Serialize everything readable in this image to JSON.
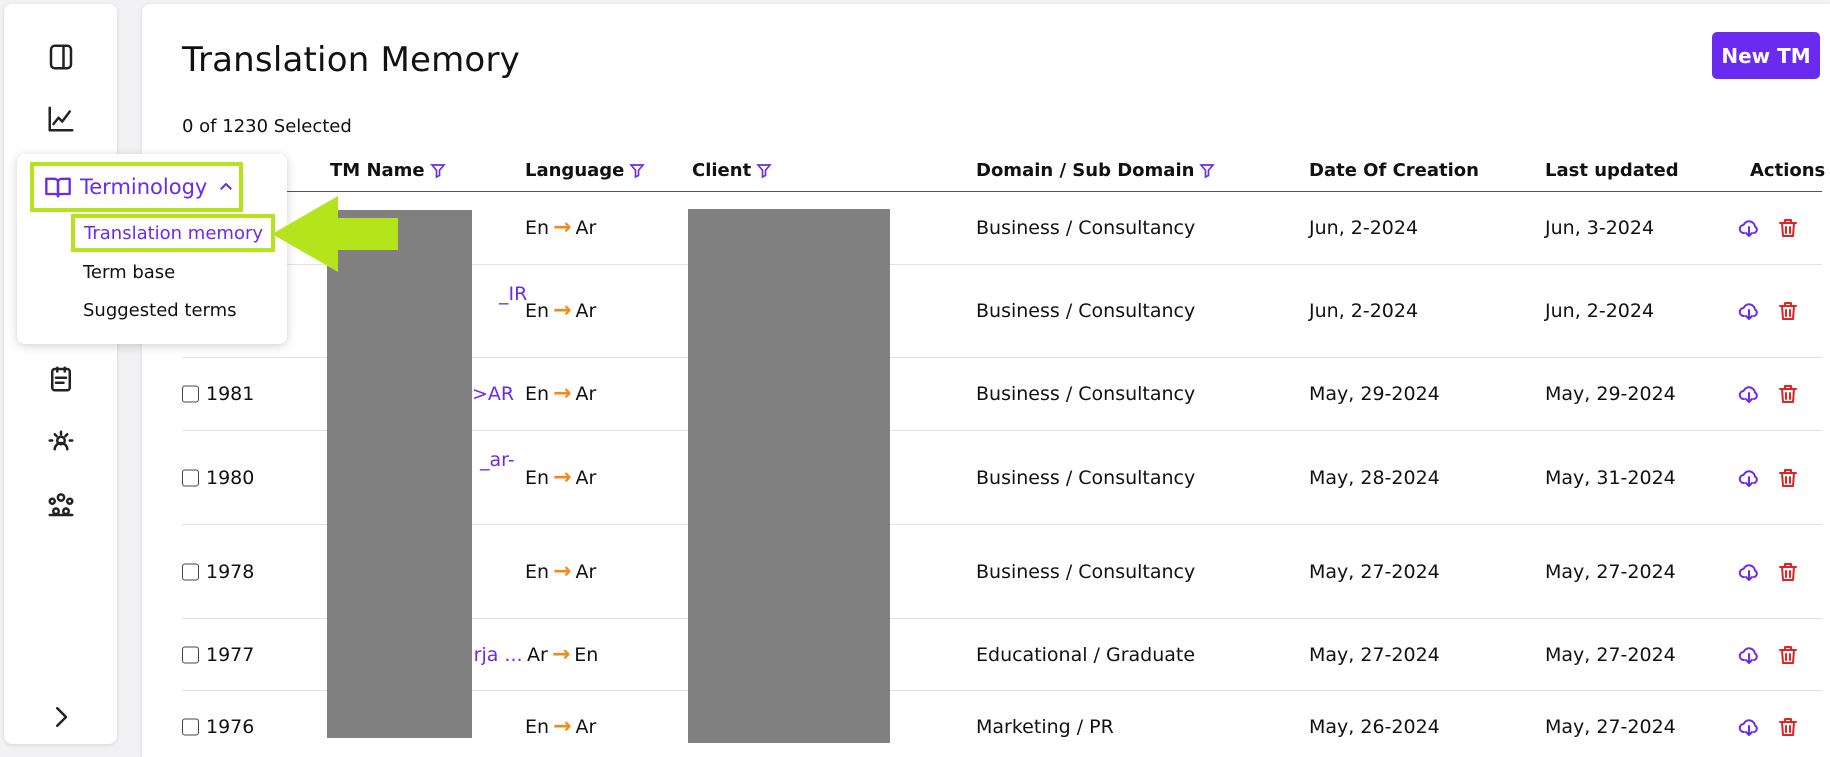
{
  "sidebar": {
    "icons": [
      "panel-toggle-icon",
      "chart-line-icon",
      "clipboard-icon",
      "brain-settings-icon",
      "team-icon",
      "chevron-right-icon"
    ]
  },
  "popup": {
    "heading": "Terminology",
    "items": [
      "Translation memory",
      "Term base",
      "Suggested terms"
    ]
  },
  "page": {
    "title": "Translation Memory",
    "new_button": "New TM",
    "selected_count": "0 of 1230 Selected"
  },
  "table": {
    "headers": {
      "tm_name": "TM Name",
      "language": "Language",
      "client": "Client",
      "domain": "Domain / Sub Domain",
      "date_created": "Date Of Creation",
      "last_updated": "Last updated",
      "actions": "Actions"
    },
    "rows": [
      {
        "id": "",
        "tm_name": "",
        "src": "En",
        "tgt": "Ar",
        "domain": "Business / Consultancy",
        "created": "Jun, 2-2024",
        "updated": "Jun, 3-2024"
      },
      {
        "id": "",
        "tm_name": "_IR",
        "src": "En",
        "tgt": "Ar",
        "domain": "Business / Consultancy",
        "created": "Jun, 2-2024",
        "updated": "Jun, 2-2024"
      },
      {
        "id": "1981",
        "tm_name": ">AR",
        "src": "En",
        "tgt": "Ar",
        "domain": "Business / Consultancy",
        "created": "May, 29-2024",
        "updated": "May, 29-2024"
      },
      {
        "id": "1980",
        "tm_name": "_ar-",
        "src": "En",
        "tgt": "Ar",
        "domain": "Business / Consultancy",
        "created": "May, 28-2024",
        "updated": "May, 31-2024"
      },
      {
        "id": "1978",
        "tm_name": "",
        "src": "En",
        "tgt": "Ar",
        "domain": "Business / Consultancy",
        "created": "May, 27-2024",
        "updated": "May, 27-2024"
      },
      {
        "id": "1977",
        "tm_name": "arja ...",
        "src": "Ar",
        "tgt": "En",
        "domain": "Educational / Graduate",
        "created": "May, 27-2024",
        "updated": "May, 27-2024"
      },
      {
        "id": "1976",
        "tm_name": "",
        "src": "En",
        "tgt": "Ar",
        "domain": "Marketing / PR",
        "created": "May, 26-2024",
        "updated": "May, 27-2024"
      }
    ]
  },
  "colors": {
    "accent": "#6a2af0",
    "highlight": "#b5e41d",
    "arrow": "#f08a1c",
    "delete": "#e02424"
  }
}
